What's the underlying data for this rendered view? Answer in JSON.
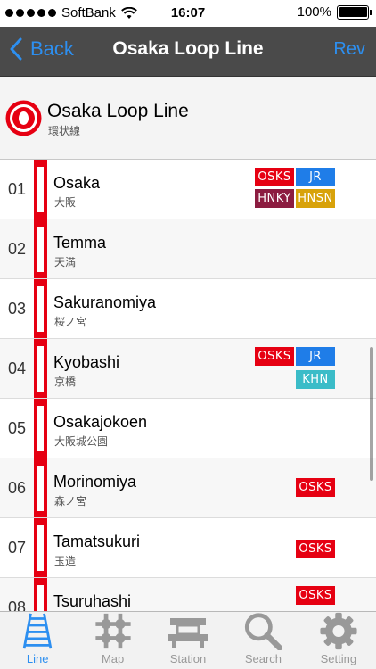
{
  "status_bar": {
    "carrier": "SoftBank",
    "time": "16:07",
    "battery": "100%",
    "battery_level": 1.0
  },
  "nav": {
    "back_label": "Back",
    "title": "Osaka Loop Line",
    "rev_label": "Rev"
  },
  "line": {
    "name": "Osaka Loop Line",
    "name_ja": "環状線",
    "color": "#e60012"
  },
  "stations": [
    {
      "num": "01",
      "name": "Osaka",
      "name_ja": "大阪",
      "badges": [
        [
          "OSKS",
          "JR"
        ],
        [
          "HNKY",
          "HNSN"
        ]
      ]
    },
    {
      "num": "02",
      "name": "Temma",
      "name_ja": "天満",
      "badges": []
    },
    {
      "num": "03",
      "name": "Sakuranomiya",
      "name_ja": "桜ノ宮",
      "badges": []
    },
    {
      "num": "04",
      "name": "Kyobashi",
      "name_ja": "京橋",
      "badges": [
        [
          "OSKS",
          "JR"
        ],
        [
          "",
          "KHN"
        ]
      ]
    },
    {
      "num": "05",
      "name": "Osakajokoen",
      "name_ja": "大阪城公園",
      "badges": []
    },
    {
      "num": "06",
      "name": "Morinomiya",
      "name_ja": "森ノ宮",
      "badges": [
        [
          "",
          "OSKS"
        ]
      ]
    },
    {
      "num": "07",
      "name": "Tamatsukuri",
      "name_ja": "玉造",
      "badges": [
        [
          "",
          "OSKS"
        ]
      ]
    },
    {
      "num": "08",
      "name": "Tsuruhashi",
      "name_ja": "",
      "badges": [
        [
          "",
          "OSKS"
        ]
      ]
    }
  ],
  "tabs": [
    {
      "label": "Line",
      "icon": "rail-track-icon",
      "active": true
    },
    {
      "label": "Map",
      "icon": "map-grid-icon",
      "active": false
    },
    {
      "label": "Station",
      "icon": "station-icon",
      "active": false
    },
    {
      "label": "Search",
      "icon": "magnifier-icon",
      "active": false
    },
    {
      "label": "Setting",
      "icon": "gear-icon",
      "active": false
    }
  ]
}
